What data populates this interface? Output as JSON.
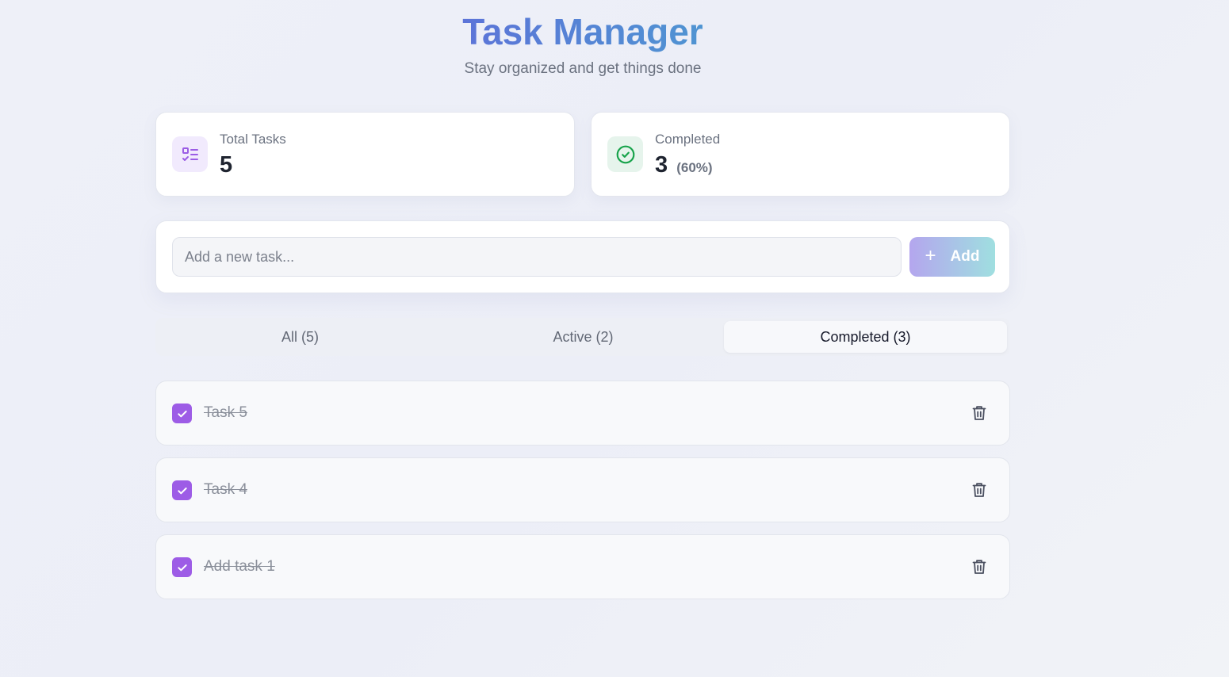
{
  "header": {
    "title": "Task Manager",
    "subtitle": "Stay organized and get things done"
  },
  "stats": {
    "total": {
      "label": "Total Tasks",
      "value": "5",
      "icon": "list-check-icon"
    },
    "completed": {
      "label": "Completed",
      "value": "3",
      "percent": "(60%)",
      "icon": "check-circle-icon"
    }
  },
  "add_task": {
    "placeholder": "Add a new task...",
    "value": "",
    "button_label": "Add",
    "button_icon": "plus-icon"
  },
  "tabs": [
    {
      "label": "All (5)",
      "active": false
    },
    {
      "label": "Active (2)",
      "active": false
    },
    {
      "label": "Completed (3)",
      "active": true
    }
  ],
  "tasks": [
    {
      "text": "Task 5",
      "completed": true
    },
    {
      "text": "Task 4",
      "completed": true
    },
    {
      "text": "Add task 1",
      "completed": true
    }
  ],
  "colors": {
    "accent": "#9d5ce6",
    "success": "#16a34a",
    "title_gradient_start": "#5c74d8",
    "title_gradient_end": "#4f94d2"
  }
}
